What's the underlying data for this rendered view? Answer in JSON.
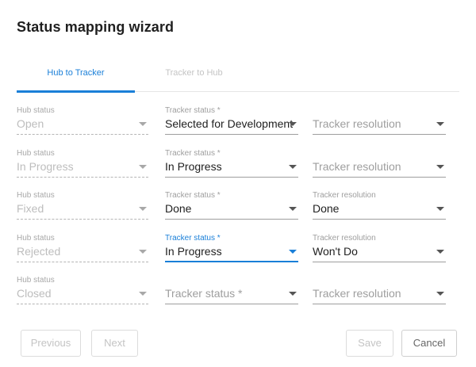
{
  "dialog": {
    "title": "Status mapping wizard"
  },
  "tabs": [
    {
      "label": "Hub to Tracker",
      "active": true
    },
    {
      "label": "Tracker to Hub",
      "active": false
    }
  ],
  "labels": {
    "hub_status": "Hub status",
    "tracker_status": "Tracker status *",
    "tracker_resolution": "Tracker resolution"
  },
  "rows": [
    {
      "hub": "Open",
      "tracker": "Selected for Development",
      "resolution": ""
    },
    {
      "hub": "In Progress",
      "tracker": "In Progress",
      "resolution": ""
    },
    {
      "hub": "Fixed",
      "tracker": "Done",
      "resolution": "Done"
    },
    {
      "hub": "Rejected",
      "tracker": "In Progress",
      "resolution": "Won't Do"
    },
    {
      "hub": "Closed",
      "tracker": "",
      "resolution": ""
    }
  ],
  "buttons": {
    "previous": "Previous",
    "next": "Next",
    "save": "Save",
    "cancel": "Cancel"
  },
  "colors": {
    "accent": "#1a7fd8"
  }
}
